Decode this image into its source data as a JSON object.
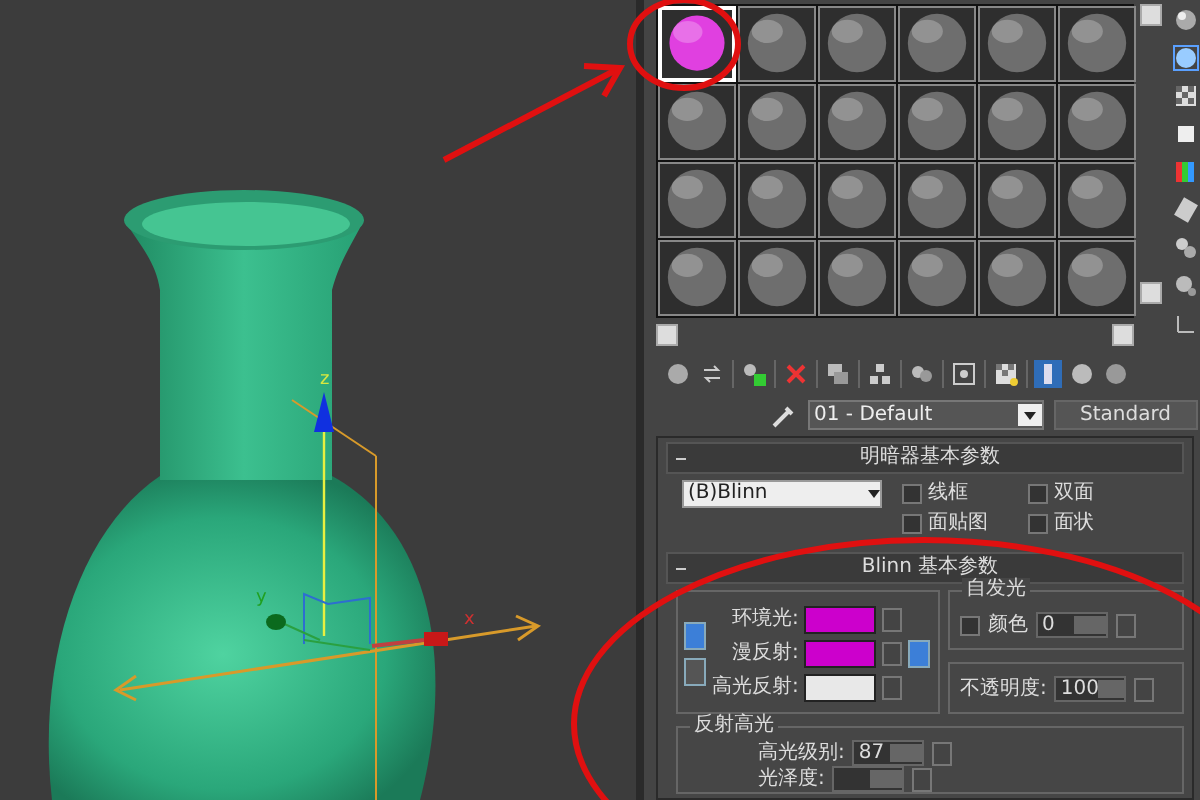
{
  "viewport": {
    "axis_labels": [
      "z",
      "y",
      "x"
    ]
  },
  "material_editor": {
    "slots": [
      {
        "selected": true,
        "color": "#e040e0"
      },
      {
        "selected": false,
        "color": "#6e6e6e"
      },
      {
        "selected": false,
        "color": "#6e6e6e"
      },
      {
        "selected": false,
        "color": "#6e6e6e"
      },
      {
        "selected": false,
        "color": "#6e6e6e"
      },
      {
        "selected": false,
        "color": "#6e6e6e"
      },
      {
        "selected": false,
        "color": "#6e6e6e"
      },
      {
        "selected": false,
        "color": "#6e6e6e"
      },
      {
        "selected": false,
        "color": "#6e6e6e"
      },
      {
        "selected": false,
        "color": "#6e6e6e"
      },
      {
        "selected": false,
        "color": "#6e6e6e"
      },
      {
        "selected": false,
        "color": "#6e6e6e"
      },
      {
        "selected": false,
        "color": "#6e6e6e"
      },
      {
        "selected": false,
        "color": "#6e6e6e"
      },
      {
        "selected": false,
        "color": "#6e6e6e"
      },
      {
        "selected": false,
        "color": "#6e6e6e"
      },
      {
        "selected": false,
        "color": "#6e6e6e"
      },
      {
        "selected": false,
        "color": "#6e6e6e"
      },
      {
        "selected": false,
        "color": "#6e6e6e"
      },
      {
        "selected": false,
        "color": "#6e6e6e"
      },
      {
        "selected": false,
        "color": "#6e6e6e"
      },
      {
        "selected": false,
        "color": "#6e6e6e"
      },
      {
        "selected": false,
        "color": "#6e6e6e"
      },
      {
        "selected": false,
        "color": "#6e6e6e"
      }
    ],
    "material_name": "01 - Default",
    "material_type": "Standard",
    "shader_rollout": {
      "title": "明暗器基本参数",
      "shader": "(B)Blinn",
      "options": [
        {
          "label": "线框",
          "checked": false
        },
        {
          "label": "双面",
          "checked": false
        },
        {
          "label": "面贴图",
          "checked": false
        },
        {
          "label": "面状",
          "checked": false
        }
      ]
    },
    "blinn_rollout": {
      "title": "Blinn 基本参数",
      "colors": [
        {
          "label": "环境光:",
          "color": "#cc00cc"
        },
        {
          "label": "漫反射:",
          "color": "#cc00cc"
        },
        {
          "label": "高光反射:",
          "color": "#e8e8e8"
        }
      ],
      "self_illumination": {
        "title": "自发光",
        "checked": false,
        "label": "颜色",
        "value": "0"
      },
      "opacity": {
        "label": "不透明度:",
        "value": "100"
      },
      "specular": {
        "title": "反射高光",
        "rows": [
          {
            "label": "高光级别:",
            "value": "87"
          },
          {
            "label": "光泽度:"
          }
        ]
      }
    }
  }
}
